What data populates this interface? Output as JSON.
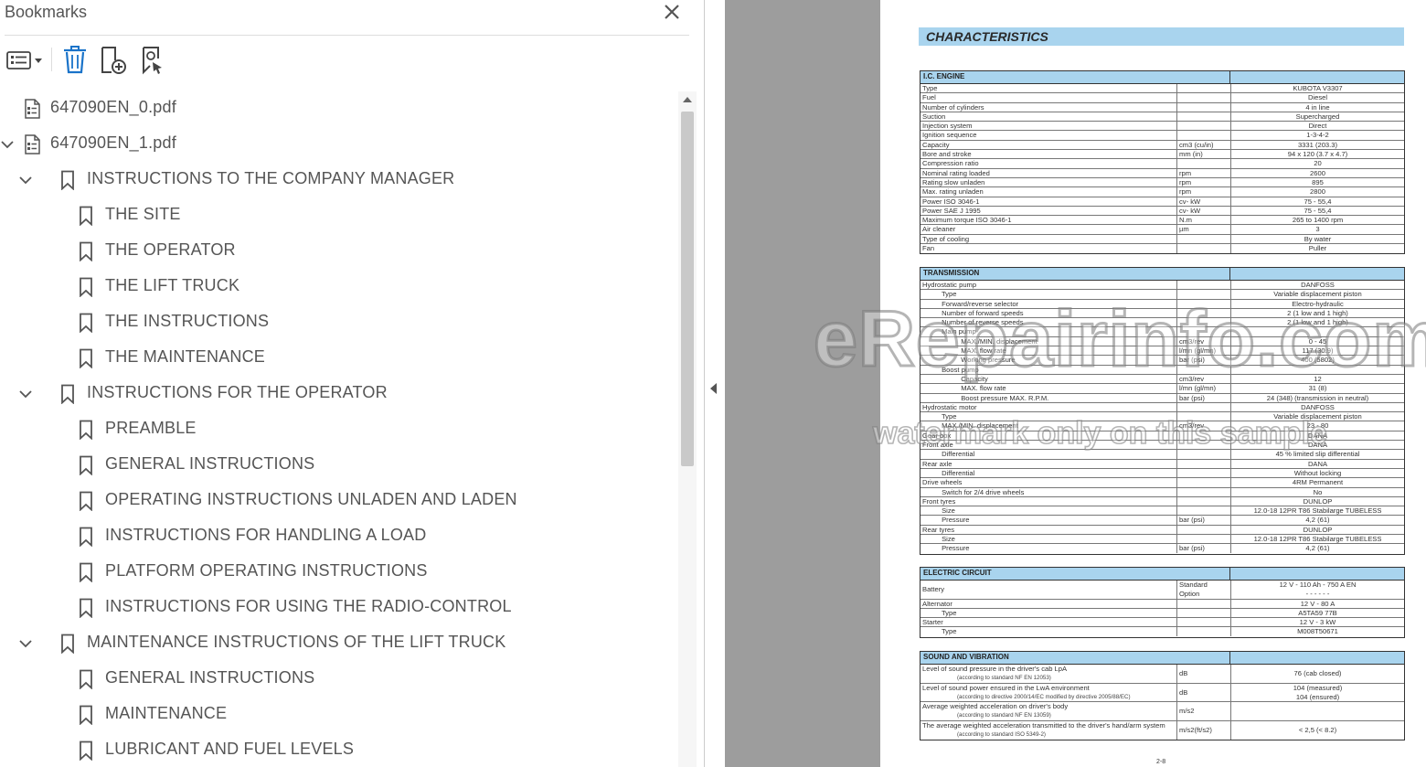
{
  "bookmarks_panel": {
    "title": "Bookmarks",
    "toolbar": {
      "options_icon": "list-options-icon",
      "delete_icon": "trash-icon",
      "new_bookmark_icon": "new-bookmark-icon",
      "find_bookmark_icon": "find-bookmark-icon"
    },
    "items": [
      {
        "label": "647090EN_0.pdf",
        "type": "file",
        "level": 0,
        "expanded": false
      },
      {
        "label": "647090EN_1.pdf",
        "type": "file",
        "level": 0,
        "expanded": true
      },
      {
        "label": "INSTRUCTIONS TO THE COMPANY MANAGER",
        "type": "bookmark",
        "level": 1,
        "expanded": true
      },
      {
        "label": "THE SITE",
        "type": "bookmark",
        "level": 2
      },
      {
        "label": "THE OPERATOR",
        "type": "bookmark",
        "level": 2
      },
      {
        "label": "THE LIFT TRUCK",
        "type": "bookmark",
        "level": 2
      },
      {
        "label": "THE INSTRUCTIONS",
        "type": "bookmark",
        "level": 2
      },
      {
        "label": "THE MAINTENANCE",
        "type": "bookmark",
        "level": 2
      },
      {
        "label": "INSTRUCTIONS FOR THE OPERATOR",
        "type": "bookmark",
        "level": 1,
        "expanded": true
      },
      {
        "label": "PREAMBLE",
        "type": "bookmark",
        "level": 2
      },
      {
        "label": "GENERAL INSTRUCTIONS",
        "type": "bookmark",
        "level": 2
      },
      {
        "label": "OPERATING INSTRUCTIONS UNLADEN AND LADEN",
        "type": "bookmark",
        "level": 2
      },
      {
        "label": "INSTRUCTIONS FOR HANDLING A LOAD",
        "type": "bookmark",
        "level": 2
      },
      {
        "label": "PLATFORM OPERATING INSTRUCTIONS",
        "type": "bookmark",
        "level": 2
      },
      {
        "label": "INSTRUCTIONS FOR USING THE RADIO-CONTROL",
        "type": "bookmark",
        "level": 2
      },
      {
        "label": "MAINTENANCE INSTRUCTIONS OF THE LIFT TRUCK",
        "type": "bookmark",
        "level": 1,
        "expanded": true
      },
      {
        "label": "GENERAL INSTRUCTIONS",
        "type": "bookmark",
        "level": 2
      },
      {
        "label": "MAINTENANCE",
        "type": "bookmark",
        "level": 2
      },
      {
        "label": "LUBRICANT AND FUEL LEVELS",
        "type": "bookmark",
        "level": 2
      }
    ]
  },
  "document": {
    "heading": "CHARACTERISTICS",
    "page_number": "2-8",
    "engine": {
      "title": "I.C. ENGINE",
      "rows": [
        [
          "Type",
          "",
          "KUBOTA V3307"
        ],
        [
          "Fuel",
          "",
          "Diesel"
        ],
        [
          "Number of cylinders",
          "",
          "4 in line"
        ],
        [
          "Suction",
          "",
          "Supercharged"
        ],
        [
          "Injection system",
          "",
          "Direct"
        ],
        [
          "Ignition sequence",
          "",
          "1-3-4-2"
        ],
        [
          "Capacity",
          "cm3 (cu/in)",
          "3331 (203.3)"
        ],
        [
          "Bore and stroke",
          "mm (in)",
          "94 x 120 (3.7 x 4.7)"
        ],
        [
          "Compression ratio",
          "",
          "20"
        ],
        [
          "Nominal rating loaded",
          "rpm",
          "2600"
        ],
        [
          "Rating slow unladen",
          "rpm",
          "895"
        ],
        [
          "Max. rating unladen",
          "rpm",
          "2800"
        ],
        [
          "Power ISO 3046-1",
          "cv- kW",
          "75 - 55,4"
        ],
        [
          "Power SAE J 1995",
          "cv- kW",
          "75 - 55,4"
        ],
        [
          "Maximum torque ISO 3046-1",
          "N.m",
          "265 to 1400 rpm"
        ],
        [
          "Air cleaner",
          "µm",
          "3"
        ],
        [
          "Type of cooling",
          "",
          "By water"
        ],
        [
          "Fan",
          "",
          "Puller"
        ]
      ]
    },
    "transmission": {
      "title": "TRANSMISSION",
      "rows": [
        [
          "Hydrostatic pump",
          "",
          "DANFOSS"
        ],
        [
          "          Type",
          "",
          "Variable displacement piston"
        ],
        [
          "          Forward/reverse selector",
          "",
          "Electro-hydraulic"
        ],
        [
          "          Number of forward speeds",
          "",
          "2 (1 low and 1 high)"
        ],
        [
          "          Number of reverse speeds",
          "",
          "2 (1 low and 1 high)"
        ],
        [
          "          Main pump",
          "",
          ""
        ],
        [
          "                    MAX./MIN. displacement",
          "cm3/rev",
          "0 - 45"
        ],
        [
          "                    MAX. flow rate",
          "l/mn (gl/mn)",
          "117 (30.9)"
        ],
        [
          "                    Working pressure",
          "bar (psi)",
          "400 (5802)"
        ],
        [
          "          Boost pump",
          "",
          ""
        ],
        [
          "                    Capacity",
          "cm3/rev",
          "12"
        ],
        [
          "                    MAX. flow rate",
          "l/mn (gl/mn)",
          "31 (8)"
        ],
        [
          "                    Boost pressure MAX. R.P.M.",
          "bar (psi)",
          "24 (348) (transmission in neutral)"
        ],
        [
          "Hydrostatic motor",
          "",
          "DANFOSS"
        ],
        [
          "          Type",
          "",
          "Variable displacement piston"
        ],
        [
          "          MAX./MIN. displacement",
          "cm3/rev",
          "23 - 80"
        ],
        [
          "Gear box",
          "",
          "DANA"
        ],
        [
          "Front axle",
          "",
          "DANA"
        ],
        [
          "          Differential",
          "",
          "45 % limited slip differential"
        ],
        [
          "Rear axle",
          "",
          "DANA"
        ],
        [
          "          Differential",
          "",
          "Without locking"
        ],
        [
          "Drive wheels",
          "",
          "4RM Permanent"
        ],
        [
          "          Switch for 2/4 drive wheels",
          "",
          "No"
        ],
        [
          "Front tyres",
          "",
          "DUNLOP"
        ],
        [
          "          Size",
          "",
          "12.0-18 12PR T86 Stabilarge TUBELESS"
        ],
        [
          "          Pressure",
          "bar (psi)",
          "4,2 (61)"
        ],
        [
          "Rear tyres",
          "",
          "DUNLOP"
        ],
        [
          "          Size",
          "",
          "12.0-18 12PR T86 Stabilarge TUBELESS"
        ],
        [
          "          Pressure",
          "bar (psi)",
          "4,2 (61)"
        ]
      ]
    },
    "electric": {
      "title": "ELECTRIC CIRCUIT",
      "battery_label": "Battery",
      "battery_standard_label": "Standard",
      "battery_standard_value": "12 V - 110 Ah - 750 A EN",
      "battery_option_label": "Option",
      "battery_option_value": "- - - - - -",
      "rows": [
        [
          "Alternator",
          "",
          "12 V - 80 A"
        ],
        [
          "          Type",
          "",
          "A5TA59 77B"
        ],
        [
          "Starter",
          "",
          "12 V - 3 kW"
        ],
        [
          "          Type",
          "",
          "M008T50671"
        ]
      ]
    },
    "sound": {
      "title": "SOUND AND VIBRATION",
      "rows": [
        {
          "main": "Level of sound pressure in the driver's cab LpA",
          "sub": "(according to standard NF EN 12053)",
          "unit": "dB",
          "value": "76 (cab closed)"
        },
        {
          "main": "Level of sound power ensured in the LwA environment",
          "sub": "(according to directive 2000/14/EC modified by directive 2005/88/EC)",
          "unit": "dB",
          "value": "104 (measured)",
          "value2": "104 (ensured)"
        },
        {
          "main": "Average weighted acceleration on driver's body",
          "sub": "(according to standard NF EN 13059)",
          "unit": "m/s2",
          "value": ""
        },
        {
          "main": "The average weighted acceleration transmitted to the driver's hand/arm system",
          "sub": "(according to standard ISO 5349-2)",
          "unit": "m/s2(ft/s2)",
          "value": "< 2,5 (< 8.2)"
        }
      ]
    }
  },
  "watermark": {
    "big": "eRepairinfo.com",
    "small": "watermark only on this sample"
  },
  "colors": {
    "table_header": "#a9d4ee",
    "gutter": "#9d9d9d"
  }
}
